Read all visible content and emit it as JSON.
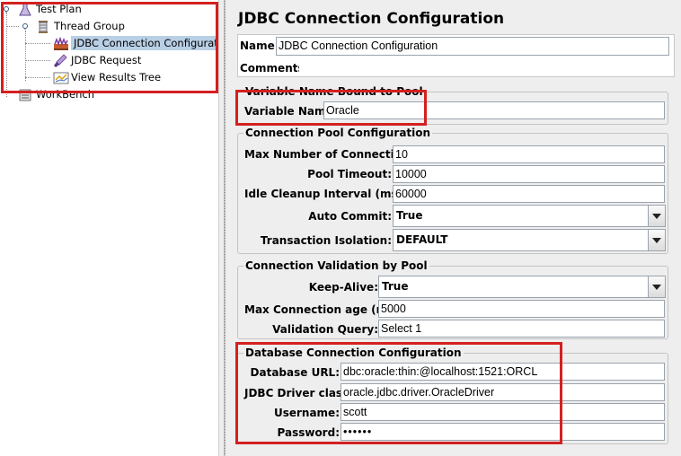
{
  "tree": {
    "items": [
      {
        "label": "Test Plan",
        "icon": "test-plan-flask-icon"
      },
      {
        "label": "Thread Group",
        "icon": "thread-group-spool-icon"
      },
      {
        "label": "JDBC Connection Configuration",
        "icon": "jdbc-config-icon",
        "selected": true
      },
      {
        "label": "JDBC Request",
        "icon": "jdbc-request-pipette-icon"
      },
      {
        "label": "View Results Tree",
        "icon": "results-tree-icon"
      },
      {
        "label": "WorkBench",
        "icon": "workbench-icon"
      }
    ]
  },
  "panel": {
    "title": "JDBC Connection Configuration",
    "name_label": "Name:",
    "name_value": "JDBC Connection Configuration",
    "comments_label": "Comments:",
    "comments_value": ""
  },
  "variable_group": {
    "legend": "Variable Name Bound to Pool",
    "variable_name_label": "Variable Name:",
    "variable_name_value": "Oracle"
  },
  "pool_group": {
    "legend": "Connection Pool Configuration",
    "max_connections_label": "Max Number of Connections:",
    "max_connections_value": "10",
    "pool_timeout_label": "Pool Timeout:",
    "pool_timeout_value": "10000",
    "idle_cleanup_label": "Idle Cleanup Interval (ms):",
    "idle_cleanup_value": "60000",
    "auto_commit_label": "Auto Commit:",
    "auto_commit_value": "True",
    "isolation_label": "Transaction Isolation:",
    "isolation_value": "DEFAULT"
  },
  "validation_group": {
    "legend": "Connection Validation by Pool",
    "keep_alive_label": "Keep-Alive:",
    "keep_alive_value": "True",
    "max_age_label": "Max Connection age (ms):",
    "max_age_value": "5000",
    "query_label": "Validation Query:",
    "query_value": "Select 1"
  },
  "db_group": {
    "legend": "Database Connection Configuration",
    "url_label": "Database URL:",
    "url_value": "dbc:oracle:thin:@localhost:1521:ORCL",
    "driver_label": "JDBC Driver class:",
    "driver_value": "oracle.jdbc.driver.OracleDriver",
    "username_label": "Username:",
    "username_value": "scott",
    "password_label": "Password:",
    "password_value": "••••••"
  },
  "colors": {
    "highlight_red": "#d42020",
    "selection_blue": "#b8cfe5",
    "panel_bg": "#eeeeee"
  }
}
